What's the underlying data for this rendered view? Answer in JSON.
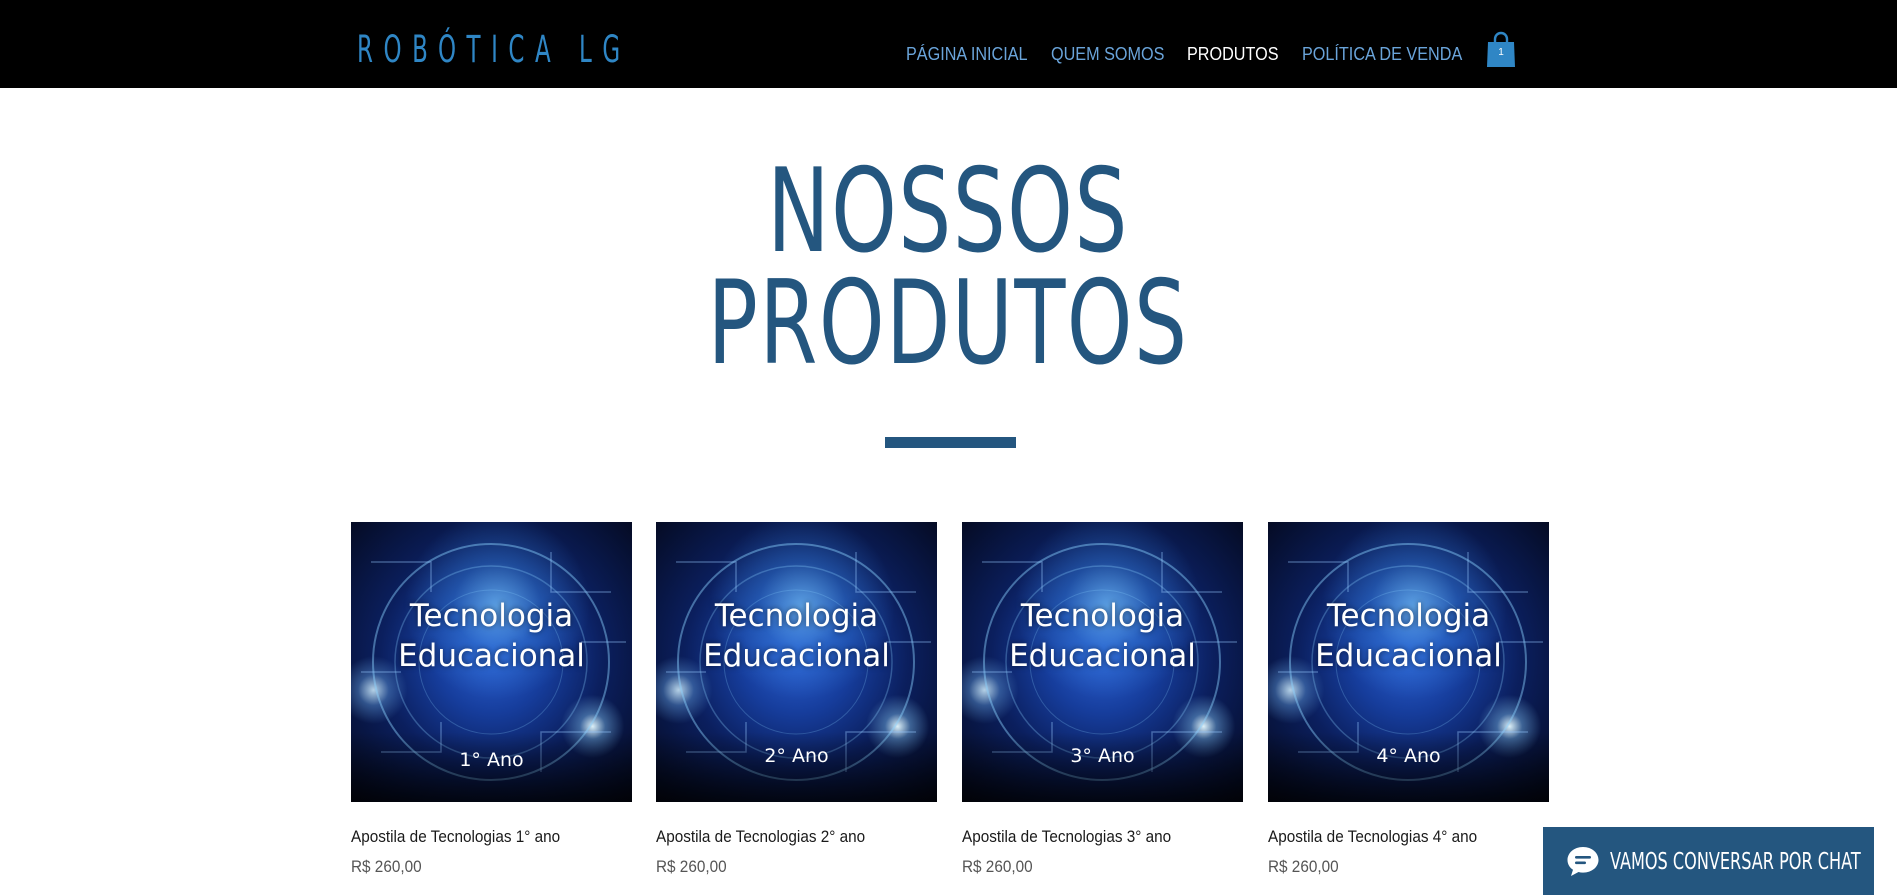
{
  "header": {
    "logo": "ROBÓTICA LG",
    "nav": [
      {
        "label": "PÁGINA INICIAL",
        "active": false
      },
      {
        "label": "QUEM SOMOS",
        "active": false
      },
      {
        "label": "PRODUTOS",
        "active": true
      },
      {
        "label": "POLÍTICA DE VENDA",
        "active": false
      }
    ],
    "cart_count": "1"
  },
  "hero": {
    "title_line1": "NOSSOS",
    "title_line2": "PRODUTOS"
  },
  "products": [
    {
      "image_title_line1": "Tecnologia",
      "image_title_line2": "Educacional",
      "image_year": "1° Ano",
      "name": "Apostila de Tecnologias 1° ano",
      "price": "R$ 260,00"
    },
    {
      "image_title_line1": "Tecnologia",
      "image_title_line2": "Educacional",
      "image_year": "2° Ano",
      "name": "Apostila de Tecnologias 2° ano",
      "price": "R$ 260,00"
    },
    {
      "image_title_line1": "Tecnologia",
      "image_title_line2": "Educacional",
      "image_year": "3° Ano",
      "name": "Apostila de Tecnologias 3° ano",
      "price": "R$ 260,00"
    },
    {
      "image_title_line1": "Tecnologia",
      "image_title_line2": "Educacional",
      "image_year": "4° Ano",
      "name": "Apostila de Tecnologias 4° ano",
      "price": "R$ 260,00"
    }
  ],
  "chat": {
    "label": "VAMOS CONVERSAR POR CHAT",
    "icon": "chat-bubble-icon"
  },
  "colors": {
    "header_bg": "#000000",
    "accent": "#24567f",
    "nav_link": "#6aa4da",
    "logo": "#2f86c5"
  }
}
